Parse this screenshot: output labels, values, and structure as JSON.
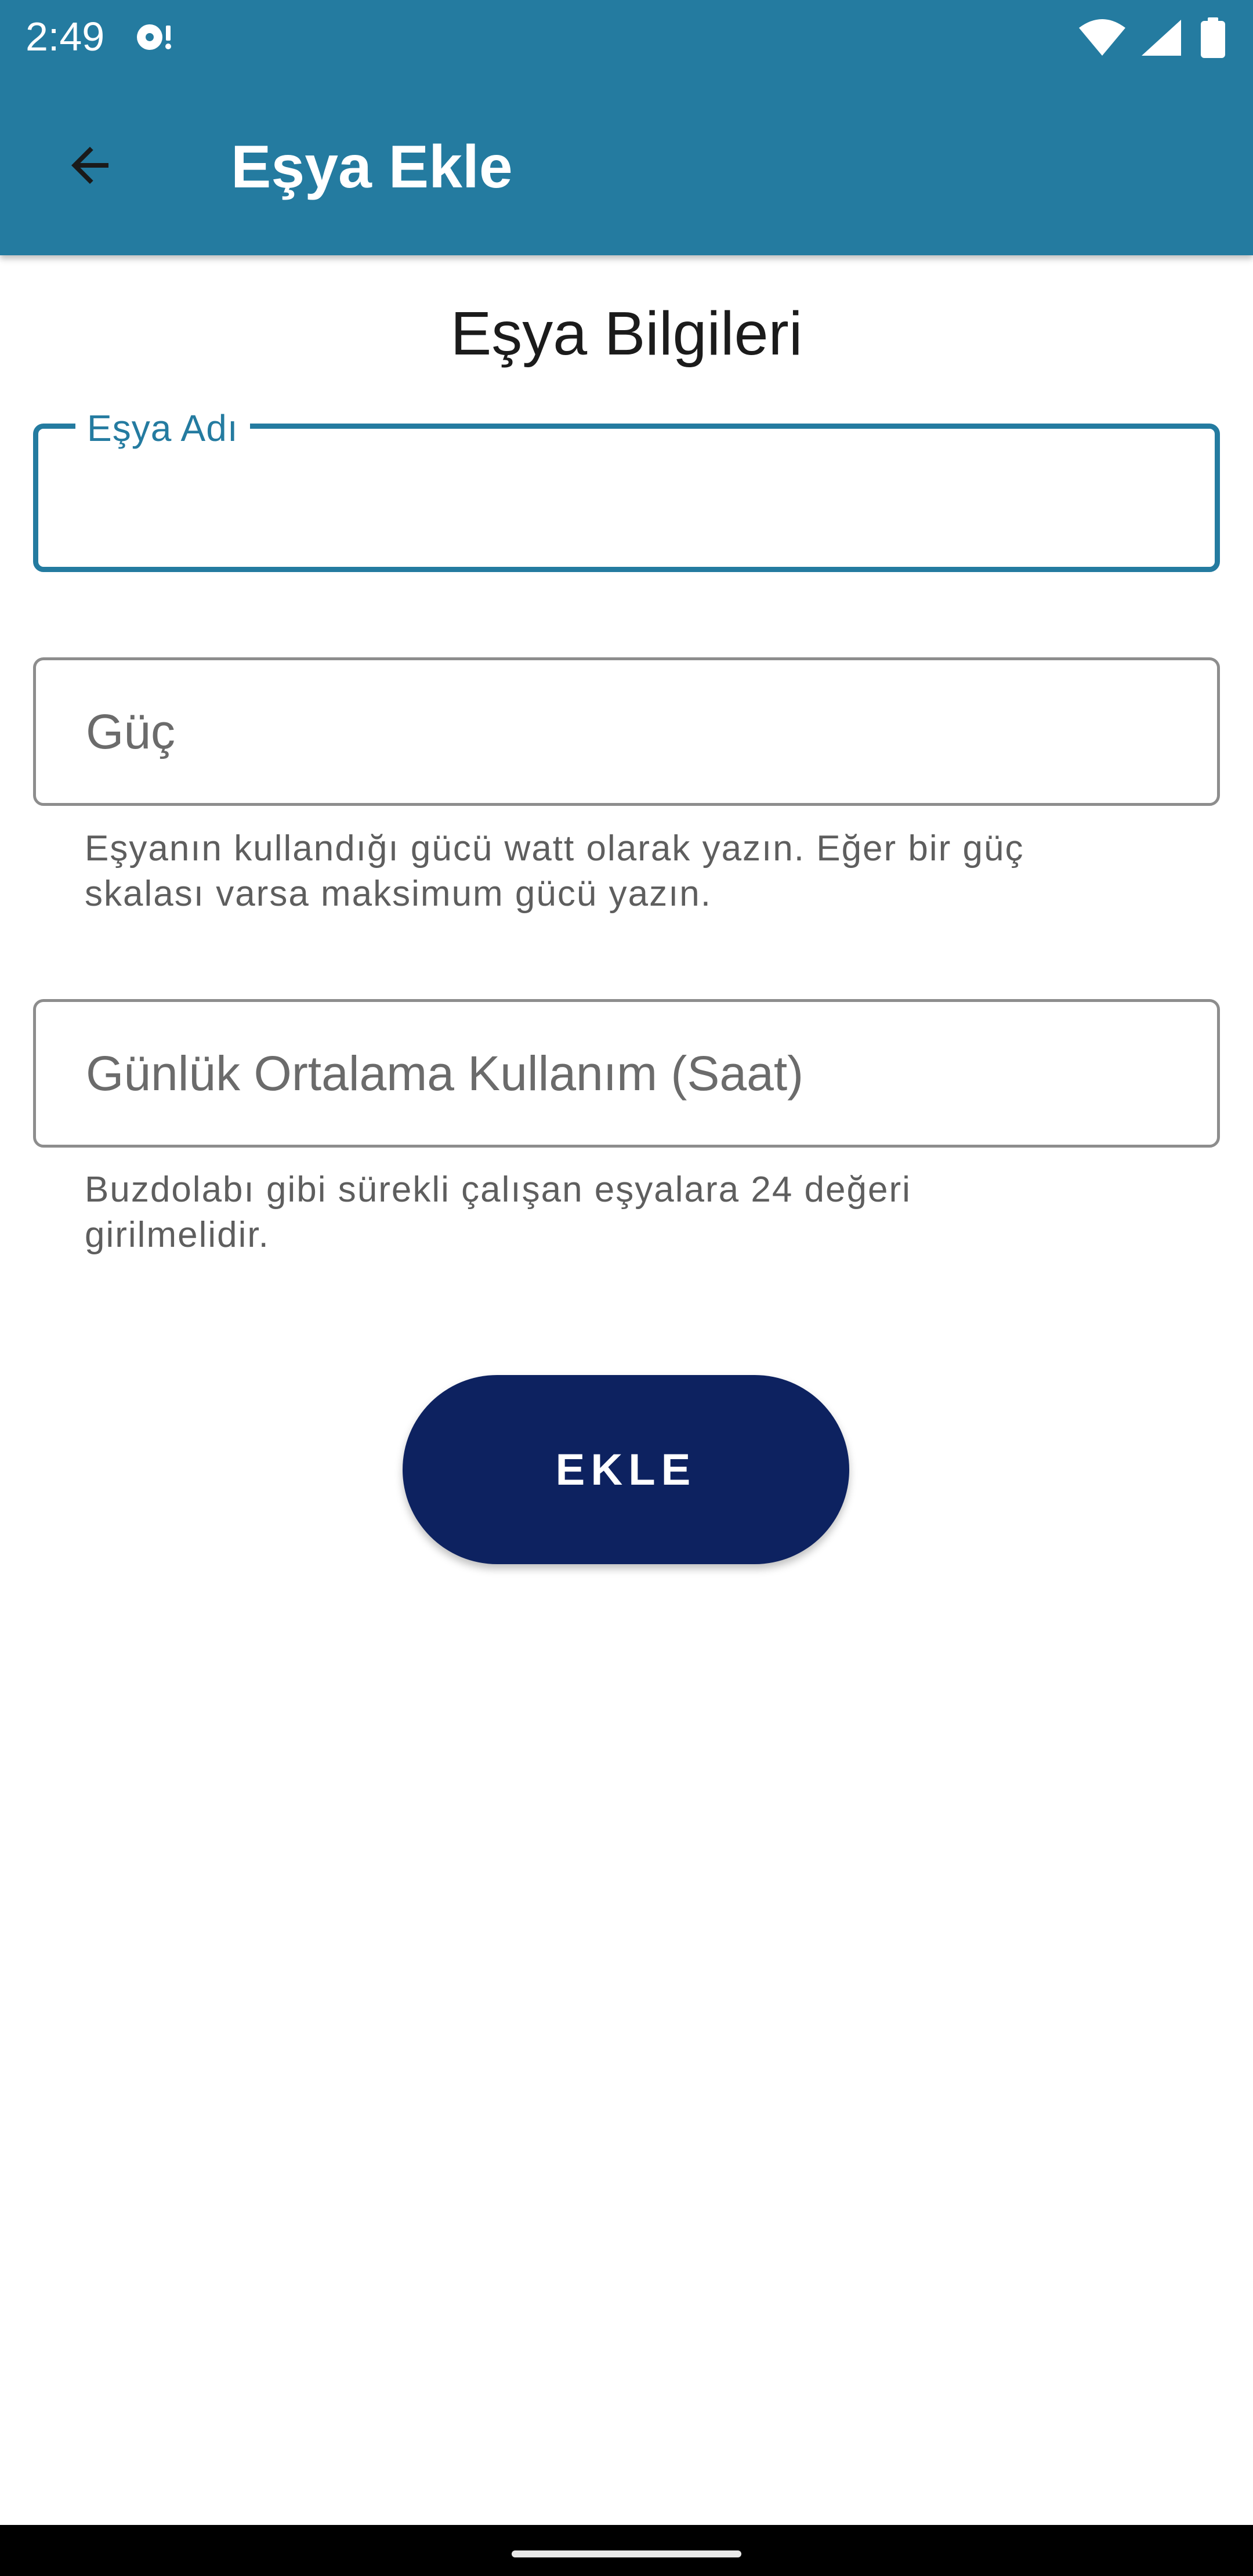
{
  "status_bar": {
    "time": "2:49",
    "media_icon": "media-notification-icon",
    "wifi_icon": "wifi-icon",
    "signal_icon": "cell-signal-icon",
    "battery_icon": "battery-icon"
  },
  "app_bar": {
    "back_icon": "arrow-back-icon",
    "title": "Eşya Ekle",
    "background_color": "#247ba0"
  },
  "form": {
    "heading": "Eşya Bilgileri",
    "fields": [
      {
        "label": "Eşya Adı",
        "value": "",
        "placeholder": "",
        "focused": true,
        "helper": ""
      },
      {
        "label": "",
        "value": "",
        "placeholder": "Güç",
        "focused": false,
        "helper_lines": [
          "Eşyanın kullandığı gücü watt olarak yazın. Eğer bir güç",
          "skalası varsa maksimum gücü yazın."
        ]
      },
      {
        "label": "",
        "value": "",
        "placeholder": "Günlük Ortalama Kullanım (Saat)",
        "focused": false,
        "helper_lines": [
          "Buzdolabı gibi sürekli çalışan eşyalara 24 değeri",
          "girilmelidir."
        ]
      }
    ],
    "submit_label": "EKLE",
    "accent_color": "#247ba0",
    "button_color": "#0d2260"
  }
}
